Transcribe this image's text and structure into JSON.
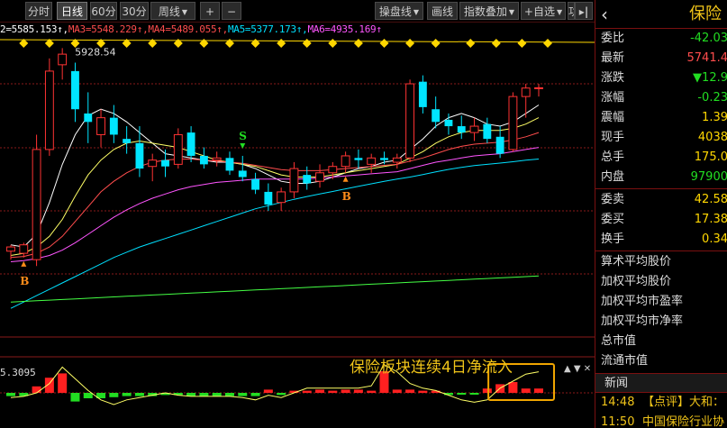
{
  "toolbar": {
    "left": [
      {
        "label": "分时",
        "active": false,
        "dropdown": false
      },
      {
        "label": "日线",
        "active": true,
        "dropdown": false
      },
      {
        "label": "60分",
        "active": false,
        "dropdown": false
      },
      {
        "label": "30分",
        "active": false,
        "dropdown": false
      },
      {
        "label": "周线",
        "active": false,
        "dropdown": true
      }
    ],
    "zoom_in": "+",
    "zoom_out": "−",
    "right": [
      {
        "label": "操盘线",
        "dropdown": true
      },
      {
        "label": "画线",
        "dropdown": false
      },
      {
        "label": "指数叠加",
        "dropdown": true
      },
      {
        "label": "+自选",
        "dropdown": true
      },
      {
        "label": "功",
        "dropdown": false
      }
    ],
    "collapse_icon": "collapse-right-icon"
  },
  "ma_legend": [
    {
      "text": "2=5585.153↑",
      "color": "#ffffff"
    },
    {
      "text": "MA3=5548.229↑",
      "color": "#ff4d4d"
    },
    {
      "text": "MA4=5489.055↑",
      "color": "#ff4d4d"
    },
    {
      "text": "MA5=5377.173↑",
      "color": "#00e0ff"
    },
    {
      "text": "MA6=4935.169↑",
      "color": "#ff55ff"
    }
  ],
  "chart_data": {
    "type": "candlestick",
    "price_label": "5928.54",
    "candles": [
      {
        "o": 4970,
        "h": 5000,
        "l": 4930,
        "c": 4990
      },
      {
        "o": 4960,
        "h": 5010,
        "l": 4940,
        "c": 5000
      },
      {
        "o": 4930,
        "h": 5520,
        "l": 4900,
        "c": 5450
      },
      {
        "o": 5450,
        "h": 5880,
        "l": 5420,
        "c": 5820
      },
      {
        "o": 5850,
        "h": 5928.54,
        "l": 5780,
        "c": 5900
      },
      {
        "o": 5820,
        "h": 5860,
        "l": 5580,
        "c": 5640
      },
      {
        "o": 5620,
        "h": 5720,
        "l": 5480,
        "c": 5580
      },
      {
        "o": 5520,
        "h": 5640,
        "l": 5460,
        "c": 5600
      },
      {
        "o": 5600,
        "h": 5660,
        "l": 5480,
        "c": 5520
      },
      {
        "o": 5500,
        "h": 5560,
        "l": 5430,
        "c": 5480
      },
      {
        "o": 5480,
        "h": 5560,
        "l": 5320,
        "c": 5360
      },
      {
        "o": 5370,
        "h": 5430,
        "l": 5300,
        "c": 5400
      },
      {
        "o": 5400,
        "h": 5450,
        "l": 5320,
        "c": 5370
      },
      {
        "o": 5380,
        "h": 5550,
        "l": 5360,
        "c": 5520
      },
      {
        "o": 5530,
        "h": 5560,
        "l": 5390,
        "c": 5420
      },
      {
        "o": 5420,
        "h": 5460,
        "l": 5360,
        "c": 5380
      },
      {
        "o": 5400,
        "h": 5440,
        "l": 5370,
        "c": 5410
      },
      {
        "o": 5410,
        "h": 5440,
        "l": 5330,
        "c": 5350
      },
      {
        "o": 5350,
        "h": 5420,
        "l": 5300,
        "c": 5320
      },
      {
        "o": 5310,
        "h": 5340,
        "l": 5240,
        "c": 5260
      },
      {
        "o": 5250,
        "h": 5290,
        "l": 5160,
        "c": 5190
      },
      {
        "o": 5200,
        "h": 5270,
        "l": 5160,
        "c": 5250
      },
      {
        "o": 5250,
        "h": 5390,
        "l": 5220,
        "c": 5360
      },
      {
        "o": 5330,
        "h": 5370,
        "l": 5260,
        "c": 5290
      },
      {
        "o": 5300,
        "h": 5380,
        "l": 5270,
        "c": 5340
      },
      {
        "o": 5340,
        "h": 5390,
        "l": 5310,
        "c": 5370
      },
      {
        "o": 5370,
        "h": 5440,
        "l": 5340,
        "c": 5420
      },
      {
        "o": 5410,
        "h": 5450,
        "l": 5360,
        "c": 5400
      },
      {
        "o": 5380,
        "h": 5430,
        "l": 5340,
        "c": 5410
      },
      {
        "o": 5410,
        "h": 5440,
        "l": 5380,
        "c": 5400
      },
      {
        "o": 5390,
        "h": 5430,
        "l": 5360,
        "c": 5410
      },
      {
        "o": 5410,
        "h": 5780,
        "l": 5390,
        "c": 5760
      },
      {
        "o": 5770,
        "h": 5800,
        "l": 5620,
        "c": 5650
      },
      {
        "o": 5640,
        "h": 5700,
        "l": 5550,
        "c": 5580
      },
      {
        "o": 5590,
        "h": 5620,
        "l": 5520,
        "c": 5560
      },
      {
        "o": 5560,
        "h": 5610,
        "l": 5500,
        "c": 5530
      },
      {
        "o": 5530,
        "h": 5600,
        "l": 5490,
        "c": 5560
      },
      {
        "o": 5570,
        "h": 5600,
        "l": 5480,
        "c": 5500
      },
      {
        "o": 5510,
        "h": 5560,
        "l": 5410,
        "c": 5430
      },
      {
        "o": 5450,
        "h": 5720,
        "l": 5440,
        "c": 5700
      },
      {
        "o": 5700,
        "h": 5760,
        "l": 5600,
        "c": 5740
      },
      {
        "o": 5740,
        "h": 5760,
        "l": 5700,
        "c": 5741.4
      }
    ],
    "ma_lines": [
      {
        "color": "#ffffff",
        "values": [
          5000,
          4990,
          5050,
          5200,
          5380,
          5520,
          5610,
          5640,
          5620,
          5580,
          5530,
          5480,
          5430,
          5420,
          5410,
          5400,
          5390,
          5390,
          5380,
          5360,
          5330,
          5300,
          5290,
          5290,
          5300,
          5320,
          5340,
          5360,
          5370,
          5390,
          5400,
          5450,
          5500,
          5560,
          5600,
          5620,
          5600,
          5570,
          5560,
          5580,
          5620,
          5660
        ]
      },
      {
        "color": "#ffff66",
        "values": [
          4950,
          4960,
          4990,
          5040,
          5120,
          5230,
          5330,
          5400,
          5450,
          5480,
          5490,
          5480,
          5470,
          5460,
          5440,
          5420,
          5400,
          5390,
          5380,
          5370,
          5350,
          5330,
          5320,
          5320,
          5320,
          5330,
          5340,
          5350,
          5360,
          5370,
          5380,
          5410,
          5440,
          5480,
          5510,
          5530,
          5540,
          5540,
          5540,
          5550,
          5570,
          5600
        ]
      },
      {
        "color": "#ff4d4d",
        "values": [
          4940,
          4945,
          4960,
          4990,
          5040,
          5110,
          5180,
          5250,
          5300,
          5340,
          5370,
          5390,
          5400,
          5405,
          5405,
          5400,
          5395,
          5390,
          5385,
          5375,
          5365,
          5355,
          5350,
          5350,
          5350,
          5355,
          5360,
          5365,
          5370,
          5375,
          5380,
          5395,
          5410,
          5430,
          5450,
          5465,
          5475,
          5480,
          5485,
          5495,
          5510,
          5530
        ]
      },
      {
        "color": "#ff55ff",
        "values": [
          4920,
          4925,
          4935,
          4950,
          4975,
          5010,
          5050,
          5090,
          5130,
          5165,
          5195,
          5220,
          5240,
          5260,
          5275,
          5285,
          5295,
          5300,
          5305,
          5310,
          5310,
          5310,
          5310,
          5312,
          5315,
          5320,
          5325,
          5330,
          5335,
          5340,
          5345,
          5360,
          5375,
          5390,
          5400,
          5410,
          5420,
          5425,
          5430,
          5440,
          5450,
          5460
        ]
      },
      {
        "color": "#00e0ff",
        "values": [
          4700,
          4730,
          4760,
          4790,
          4820,
          4850,
          4880,
          4910,
          4940,
          4965,
          4990,
          5010,
          5030,
          5050,
          5070,
          5090,
          5110,
          5130,
          5150,
          5170,
          5185,
          5200,
          5215,
          5228,
          5240,
          5252,
          5264,
          5276,
          5288,
          5300,
          5310,
          5320,
          5332,
          5344,
          5356,
          5366,
          5374,
          5380,
          5386,
          5392,
          5400,
          5405
        ]
      },
      {
        "color": "#44ff44",
        "values": [
          4730,
          4733,
          4736,
          4739,
          4742,
          4745,
          4748,
          4751,
          4754,
          4757,
          4760,
          4763,
          4766,
          4769,
          4772,
          4775,
          4778,
          4781,
          4784,
          4787,
          4790,
          4793,
          4796,
          4799,
          4802,
          4805,
          4808,
          4811,
          4814,
          4817,
          4820,
          4823,
          4826,
          4829,
          4832,
          4835,
          4838,
          4841,
          4844,
          4847,
          4850,
          4853
        ]
      }
    ],
    "signals": [
      {
        "index": 1,
        "label": "B",
        "color": "#ff8c1a"
      },
      {
        "index": 18,
        "label": "S",
        "color": "#22dd22"
      },
      {
        "index": 26,
        "label": "B",
        "color": "#ff8c1a"
      }
    ],
    "subchart": {
      "value_label": "5.3095",
      "bars": [
        -3,
        -3,
        6,
        14,
        18,
        -8,
        -5,
        -5,
        -4,
        -3,
        -3,
        -3,
        -2,
        -2,
        -3,
        -3,
        -3,
        -3,
        -3,
        -3,
        3,
        -2,
        2,
        2,
        3,
        2,
        3,
        3,
        2,
        20,
        3,
        3,
        2,
        2,
        -2,
        -1,
        -1,
        4,
        8,
        10,
        4,
        4
      ],
      "line": [
        -4,
        -3,
        0,
        8,
        22,
        12,
        2,
        -6,
        -10,
        -6,
        -4,
        -2,
        0,
        -2,
        -3,
        -3,
        -3,
        -3,
        -4,
        -6,
        -2,
        -4,
        0,
        4,
        4,
        4,
        4,
        4,
        6,
        24,
        18,
        8,
        4,
        2,
        -2,
        -6,
        -8,
        -6,
        4,
        10,
        16,
        18
      ]
    },
    "highlight_range": [
      38,
      41
    ]
  },
  "annotation": "保险板块连续4日净流入",
  "panel": {
    "title": "保险",
    "rows": [
      {
        "label": "委比",
        "value": "-42.03",
        "color": "#22dd22"
      },
      {
        "label": "最新",
        "value": "5741.4",
        "color": "#ff4d4d"
      },
      {
        "label": "涨跌",
        "value": "▼12.9",
        "color": "#22dd22"
      },
      {
        "label": "涨幅",
        "value": "-0.23",
        "color": "#22dd22"
      },
      {
        "label": "震幅",
        "value": "1.39",
        "color": "#ffd700"
      },
      {
        "label": "现手",
        "value": "4038",
        "color": "#ffd700"
      },
      {
        "label": "总手",
        "value": "175.0",
        "color": "#ffd700"
      },
      {
        "label": "内盘",
        "value": "97900",
        "color": "#22dd22"
      }
    ],
    "rows2": [
      {
        "label": "委卖",
        "value": "42.58",
        "color": "#ffd700"
      },
      {
        "label": "委买",
        "value": "17.38",
        "color": "#ffd700"
      },
      {
        "label": "换手",
        "value": "0.34",
        "color": "#ffd700"
      }
    ],
    "extra": [
      "算术平均股价",
      "加权平均股价",
      "加权平均市盈率",
      "加权平均市净率",
      "总市值",
      "流通市值"
    ],
    "news_title": "新闻",
    "news": [
      {
        "time": "14:48",
        "text": "【点评】大和："
      },
      {
        "time": "11:50",
        "text": "中国保险行业协"
      }
    ]
  }
}
